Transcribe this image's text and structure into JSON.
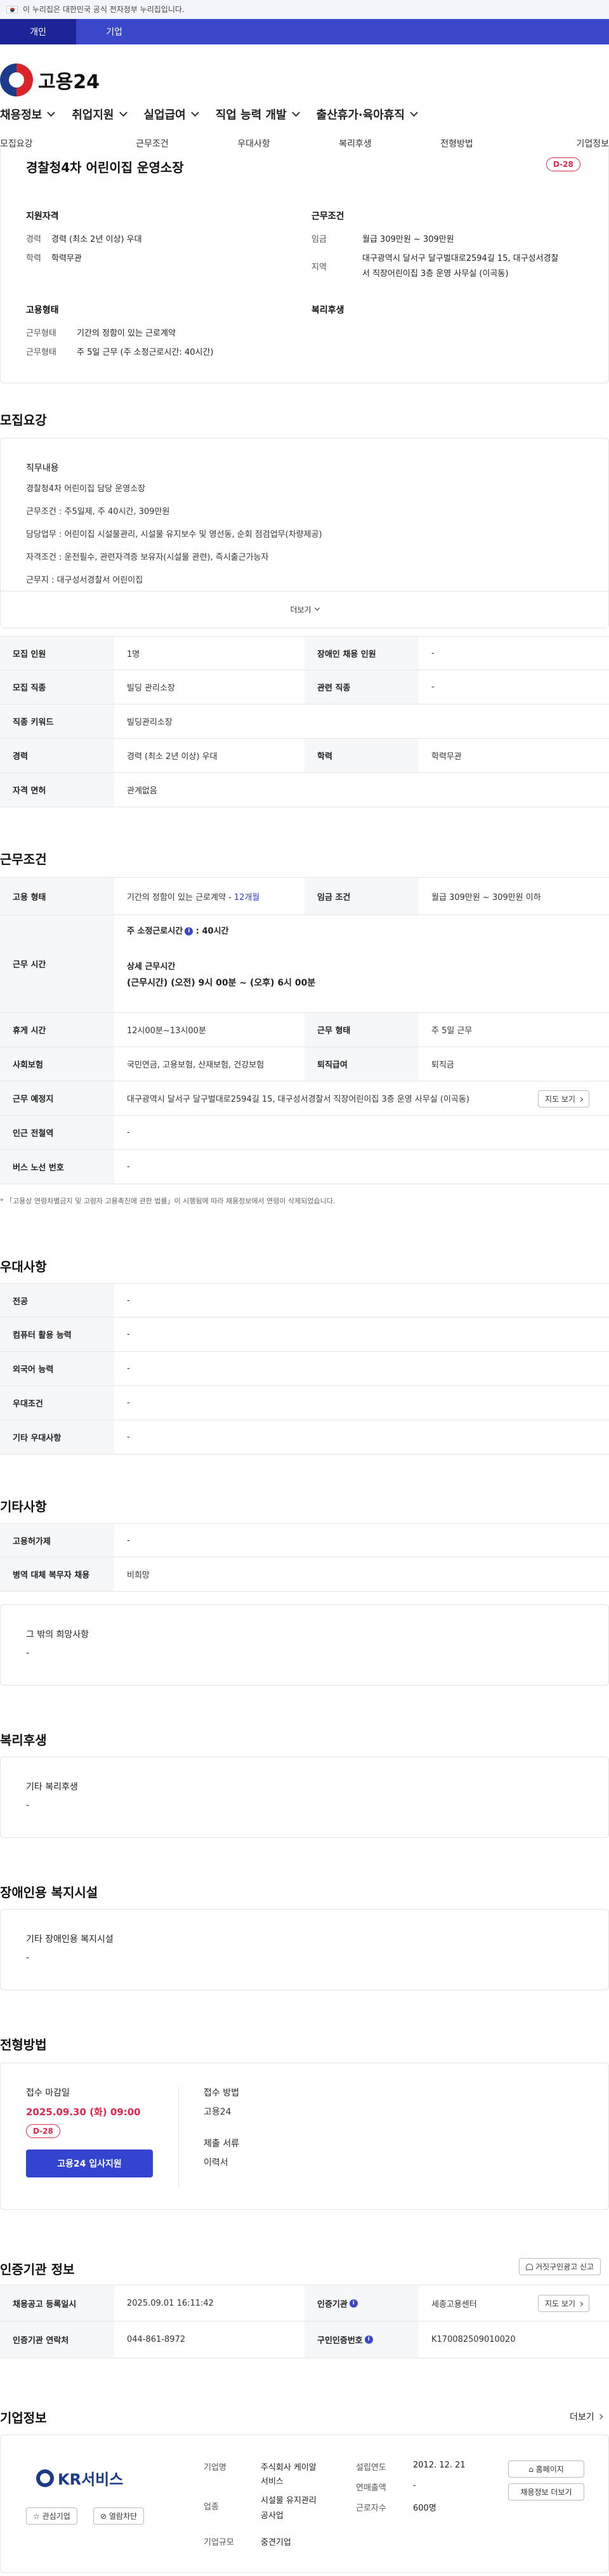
{
  "gov_banner": "이 누리집은 대한민국 공식 전자정부 누리집입니다.",
  "audience_tabs": [
    "개인",
    "기업"
  ],
  "logo": "고용24",
  "main_nav": [
    "채용정보",
    "취업지원",
    "실업급여",
    "직업 능력 개발",
    "출산휴가·육아휴직"
  ],
  "anchor_tabs": [
    "모집요강",
    "근무조건",
    "우대사항",
    "복리후생",
    "전형방법",
    "기업정보"
  ],
  "summary": {
    "title": "경찰청4차 어린이집 운영소장",
    "dday": "D-28",
    "qual_heading": "지원자격",
    "career_label": "경력",
    "career_value": "경력 (최소 2년 이상) 우대",
    "edu_label": "학력",
    "edu_value": "학력무관",
    "cond_heading": "근무조건",
    "wage_label": "임금",
    "wage_value": "월급 309만원 ~ 309만원",
    "region_label": "지역",
    "region_value_1": "대구광역시 달서구 달구벌대로2594길 15, 대구성서경찰",
    "region_value_2": "서 직장어린이집 3층 운영 사무실 (이곡동)",
    "emp_heading": "고용형태",
    "emptype_label": "근무형태",
    "emptype_value": "기간의 정함이 있는 근로계약",
    "worktype_label": "근무형태",
    "worktype_value": "주 5일 근무 (주 소정근로시간: 40시간)",
    "benefit_heading": "복리후생"
  },
  "recruit": {
    "heading": "모집요강",
    "duty_heading": "직무내용",
    "lines": [
      "경찰청4차 어린이집 담당 운영소장",
      "근무조건 : 주5일제, 주 40시간, 309만원",
      "담당업무 : 어린이집 시설물관리, 시설물 유지보수 및 영선동, 순회 점검업무(차량제공)",
      "자격조건 : 운전필수, 관련자격증 보유자(시설물 관련), 즉시출근가능자",
      "근무지 : 대구성서경찰서 어린이집"
    ],
    "more": "더보기",
    "rows": [
      {
        "k1": "모집 인원",
        "v1": "1명",
        "k2": "장애인 채용 인원",
        "v2": "-"
      },
      {
        "k1": "모집 직종",
        "v1": "빌딩 관리소장",
        "k2": "관련 직종",
        "v2": "-"
      },
      {
        "k1": "직종 키워드",
        "v1": "빌딩관리소장"
      },
      {
        "k1": "경력",
        "v1": "경력 (최소 2년 이상) 우대",
        "k2": "학력",
        "v2": "학력무관"
      },
      {
        "k1": "자격 면허",
        "v1": "관계없음"
      }
    ]
  },
  "conditions": {
    "heading": "근무조건",
    "emp_k": "고용 형태",
    "emp_v": "기간의 정함이 있는 근로계약 -",
    "emp_months": "12개월",
    "wage_k": "임금 조건",
    "wage_v": "월급 309만원 ~ 309만원 이하",
    "hours_k": "근무 시간",
    "hours_std": "주 소정근로시간",
    "hours_std_v": ": 40시간",
    "hours_detail_heading": "상세 근무시간",
    "hours_detail": "(근무시간) (오전) 9시 00분 ~ (오후) 6시 00분",
    "rest_k": "휴게 시간",
    "rest_v": "12시00분~13시00분",
    "form_k": "근무 형태",
    "form_v": "주 5일 근무",
    "ins_k": "사회보험",
    "ins_v": "국민연금, 고용보험, 산재보험, 건강보험",
    "sev_k": "퇴직급여",
    "sev_v": "퇴직금",
    "addr_k": "근무 예정지",
    "addr_v": "대구광역시 달서구 달구벌대로2594길 15, 대구성서경찰서 직장어린이집 3층 운영 사무실 (이곡동)",
    "map_btn": "지도 보기",
    "subway_k": "인근 전철역",
    "subway_v": "-",
    "bus_k": "버스 노선 번호",
    "bus_v": "-",
    "note": "「고용상 연령차별금지 및 고령자 고용촉진에 관한 법률」이 시행됨에 따라 채용정보에서 연령이 삭제되었습니다."
  },
  "preference": {
    "heading": "우대사항",
    "rows": [
      {
        "k": "전공",
        "v": "-"
      },
      {
        "k": "컴퓨터 활용 능력",
        "v": "-"
      },
      {
        "k": "외국어 능력",
        "v": "-"
      },
      {
        "k": "우대조건",
        "v": "-"
      },
      {
        "k": "기타 우대사항",
        "v": "-"
      }
    ]
  },
  "etc": {
    "heading": "기타사항",
    "rows": [
      {
        "k": "고용허가제",
        "v": "-"
      },
      {
        "k": "병역 대체 복무자 채용",
        "v": "비희망"
      }
    ],
    "box_title": "그 밖의 희망사항",
    "box_value": "-"
  },
  "welfare": {
    "heading": "복리후생",
    "box_title": "기타 복리후생",
    "box_value": "-"
  },
  "disabled": {
    "heading": "장애인용 복지시설",
    "box_title": "기타 장애인용 복지시설",
    "box_value": "-"
  },
  "selection": {
    "heading": "전형방법",
    "deadline_label": "접수 마감일",
    "deadline": "2025.09.30 (화) 09:00",
    "dday": "D-28",
    "apply_btn": "고용24 입사지원",
    "method_label": "접수 방법",
    "method": "고용24",
    "docs_label": "제출 서류",
    "docs": "이력서"
  },
  "cert": {
    "heading": "인증기관 정보",
    "report_btn": "거짓구인광고 신고",
    "reg_k": "채용공고 등록일시",
    "reg_v": "2025.09.01 16:11:42",
    "org_k": "인증기관",
    "org_v": "세종고용센터",
    "org_btn": "지도 보기",
    "tel_k": "인증기관 연락처",
    "tel_v": "044-861-8972",
    "no_k": "구인인증번호",
    "no_v": "K170082509010020"
  },
  "company": {
    "heading": "기업정보",
    "more": "더보기",
    "logo": "KR서비스",
    "fav_btn": "관심기업",
    "block_btn": "열람차단",
    "name_k": "기업명",
    "name_v_1": "주식회사 케이알",
    "name_v_2": "서비스",
    "biz_k": "업종",
    "biz_v_1": "시설물 유지관리",
    "biz_v_2": "공사업",
    "size_k": "기업규모",
    "size_v": "중견기업",
    "est_k": "설립연도",
    "est_v": "2012. 12. 21",
    "sales_k": "연매출액",
    "sales_v": "-",
    "emp_k": "근로자수",
    "emp_v": "600명",
    "home_btn": "홈페이지",
    "jobs_btn": "채용정보 더보기"
  }
}
